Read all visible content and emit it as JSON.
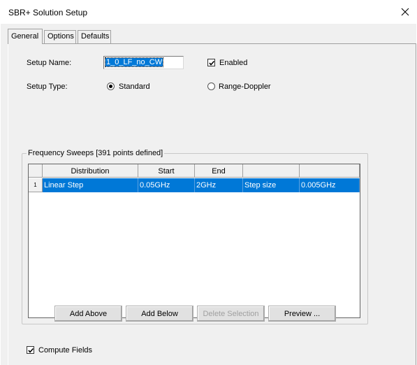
{
  "window": {
    "title": "SBR+ Solution Setup"
  },
  "tabs": [
    "General",
    "Options",
    "Defaults"
  ],
  "general": {
    "setup_name_label": "Setup Name:",
    "setup_name_value": "1_0_LF_no_CW",
    "enabled_label": "Enabled",
    "enabled_checked": true,
    "setup_type_label": "Setup Type:",
    "setup_type_options": [
      "Standard",
      "Range-Doppler"
    ],
    "setup_type_selected": "Standard",
    "freq_group_title": "Frequency Sweeps [391 points defined]",
    "sweep_table": {
      "columns": [
        "Distribution",
        "Start",
        "End",
        "",
        ""
      ],
      "rows": [
        {
          "index": "1",
          "cells": [
            "Linear Step",
            "0.05GHz",
            "2GHz",
            "Step size",
            "0.005GHz"
          ],
          "selected": true
        }
      ]
    },
    "buttons": {
      "add_above": "Add Above",
      "add_below": "Add Below",
      "delete_selection": "Delete Selection",
      "preview": "Preview ..."
    },
    "compute_fields_label": "Compute Fields",
    "compute_fields_checked": true
  },
  "colors": {
    "selection": "#0078d7",
    "dialog_bg": "#f0f0f0"
  },
  "icons": {
    "close": "close-icon",
    "check": "checkmark-icon"
  }
}
